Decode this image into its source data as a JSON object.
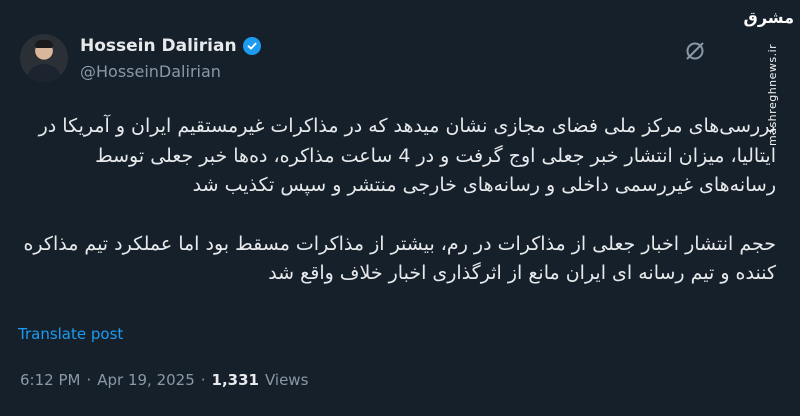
{
  "author": {
    "name": "Hossein Dalirian",
    "handle": "@HosseinDalirian"
  },
  "watermark": {
    "logo": "مشرق",
    "site": "mashreghnews.ir"
  },
  "tweet": {
    "paragraph1": "بررسی‌های مرکز ملی فضای مجازی نشان میدهد که در مذاکرات غیرمستقیم ایران و آمریکا در ایتالیا، میزان انتشار خبر جعلی اوج گرفت و در 4 ساعت مذاکره، ده‌ها خبر جعلی توسط رسانه‌های غیررسمی داخلی و رسانه‌های خارجی منتشر و سپس تکذیب شد",
    "paragraph2": "حجم انتشار اخبار جعلی از مذاکرات در رم، بیشتر از مذاکرات مسقط بود اما عملکرد تیم مذاکره کننده و تیم رسانه ای ایران مانع از اثرگذاری اخبار خلاف واقع شد",
    "translate_label": "Translate post"
  },
  "meta": {
    "time": "6:12 PM",
    "separator1": "·",
    "date": "Apr 19, 2025",
    "separator2": "·",
    "views_count": "1,331",
    "views_label": "Views"
  },
  "colors": {
    "background": "#15202b",
    "link": "#1d9bf0",
    "secondary": "#8b98a5"
  },
  "icons": [
    "verified-badge-icon",
    "grok-icon"
  ]
}
